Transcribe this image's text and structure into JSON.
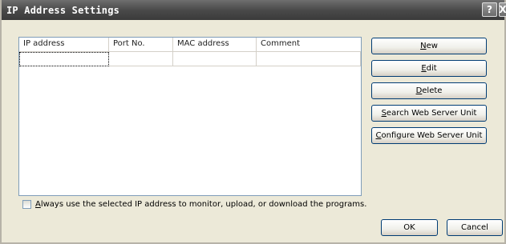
{
  "window": {
    "title": "IP Address Settings",
    "help_glyph": "?",
    "close_glyph": "X"
  },
  "table": {
    "columns": [
      "IP address",
      "Port No.",
      "MAC address",
      "Comment"
    ],
    "rows": [
      [
        "",
        "",
        "",
        ""
      ]
    ]
  },
  "buttons": {
    "new": {
      "mnemonic": "N",
      "rest": "ew"
    },
    "edit": {
      "mnemonic": "E",
      "rest": "dit"
    },
    "delete": {
      "mnemonic": "D",
      "rest": "elete"
    },
    "search": {
      "mnemonic": "S",
      "rest": "earch Web Server Unit"
    },
    "configure": {
      "mnemonic": "C",
      "rest": "onfigure Web Server Unit"
    },
    "ok": "OK",
    "cancel": "Cancel"
  },
  "checkbox": {
    "checked": false,
    "mnemonic": "A",
    "rest": "lways use the selected IP address to monitor, upload, or download the programs."
  }
}
